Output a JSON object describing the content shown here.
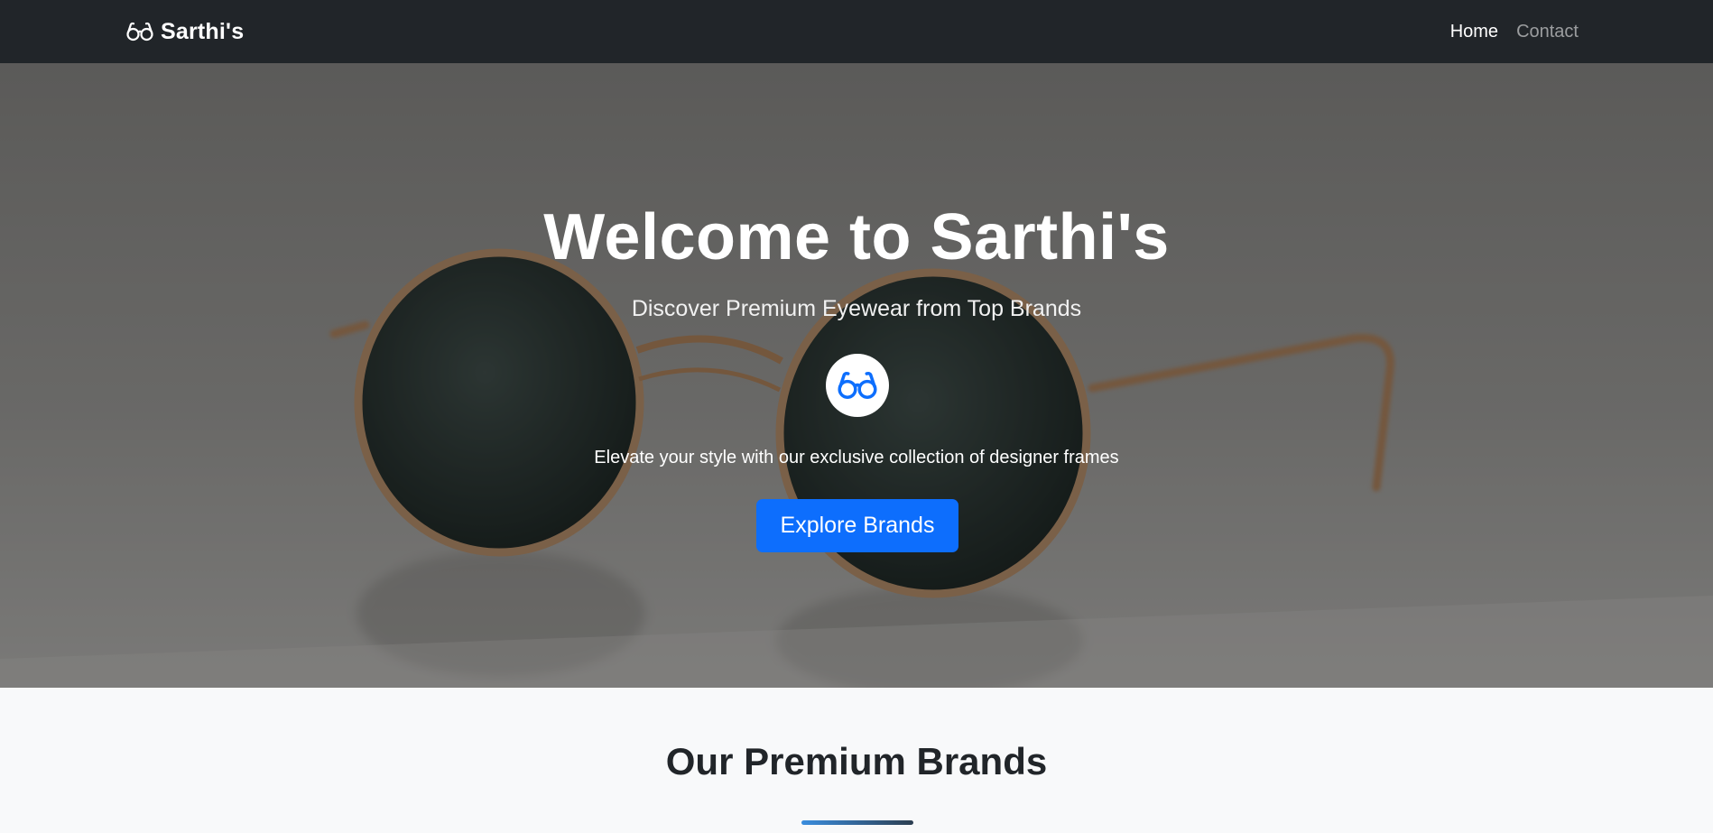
{
  "navbar": {
    "brand_icon": "glasses-icon",
    "brand_text": "Sarthi's",
    "links": [
      {
        "label": "Home",
        "active": true
      },
      {
        "label": "Contact",
        "active": false
      }
    ]
  },
  "hero": {
    "title": "Welcome to Sarthi's",
    "subtitle": "Discover Premium Eyewear from Top Brands",
    "badge_icon": "glasses-icon",
    "tagline": "Elevate your style with our exclusive collection of designer frames",
    "button_label": "Explore Brands"
  },
  "brands_section": {
    "title": "Our Premium Brands"
  },
  "colors": {
    "navbar_bg": "#212529",
    "primary": "#0d6efd",
    "section_bg": "#f8f9fa"
  }
}
